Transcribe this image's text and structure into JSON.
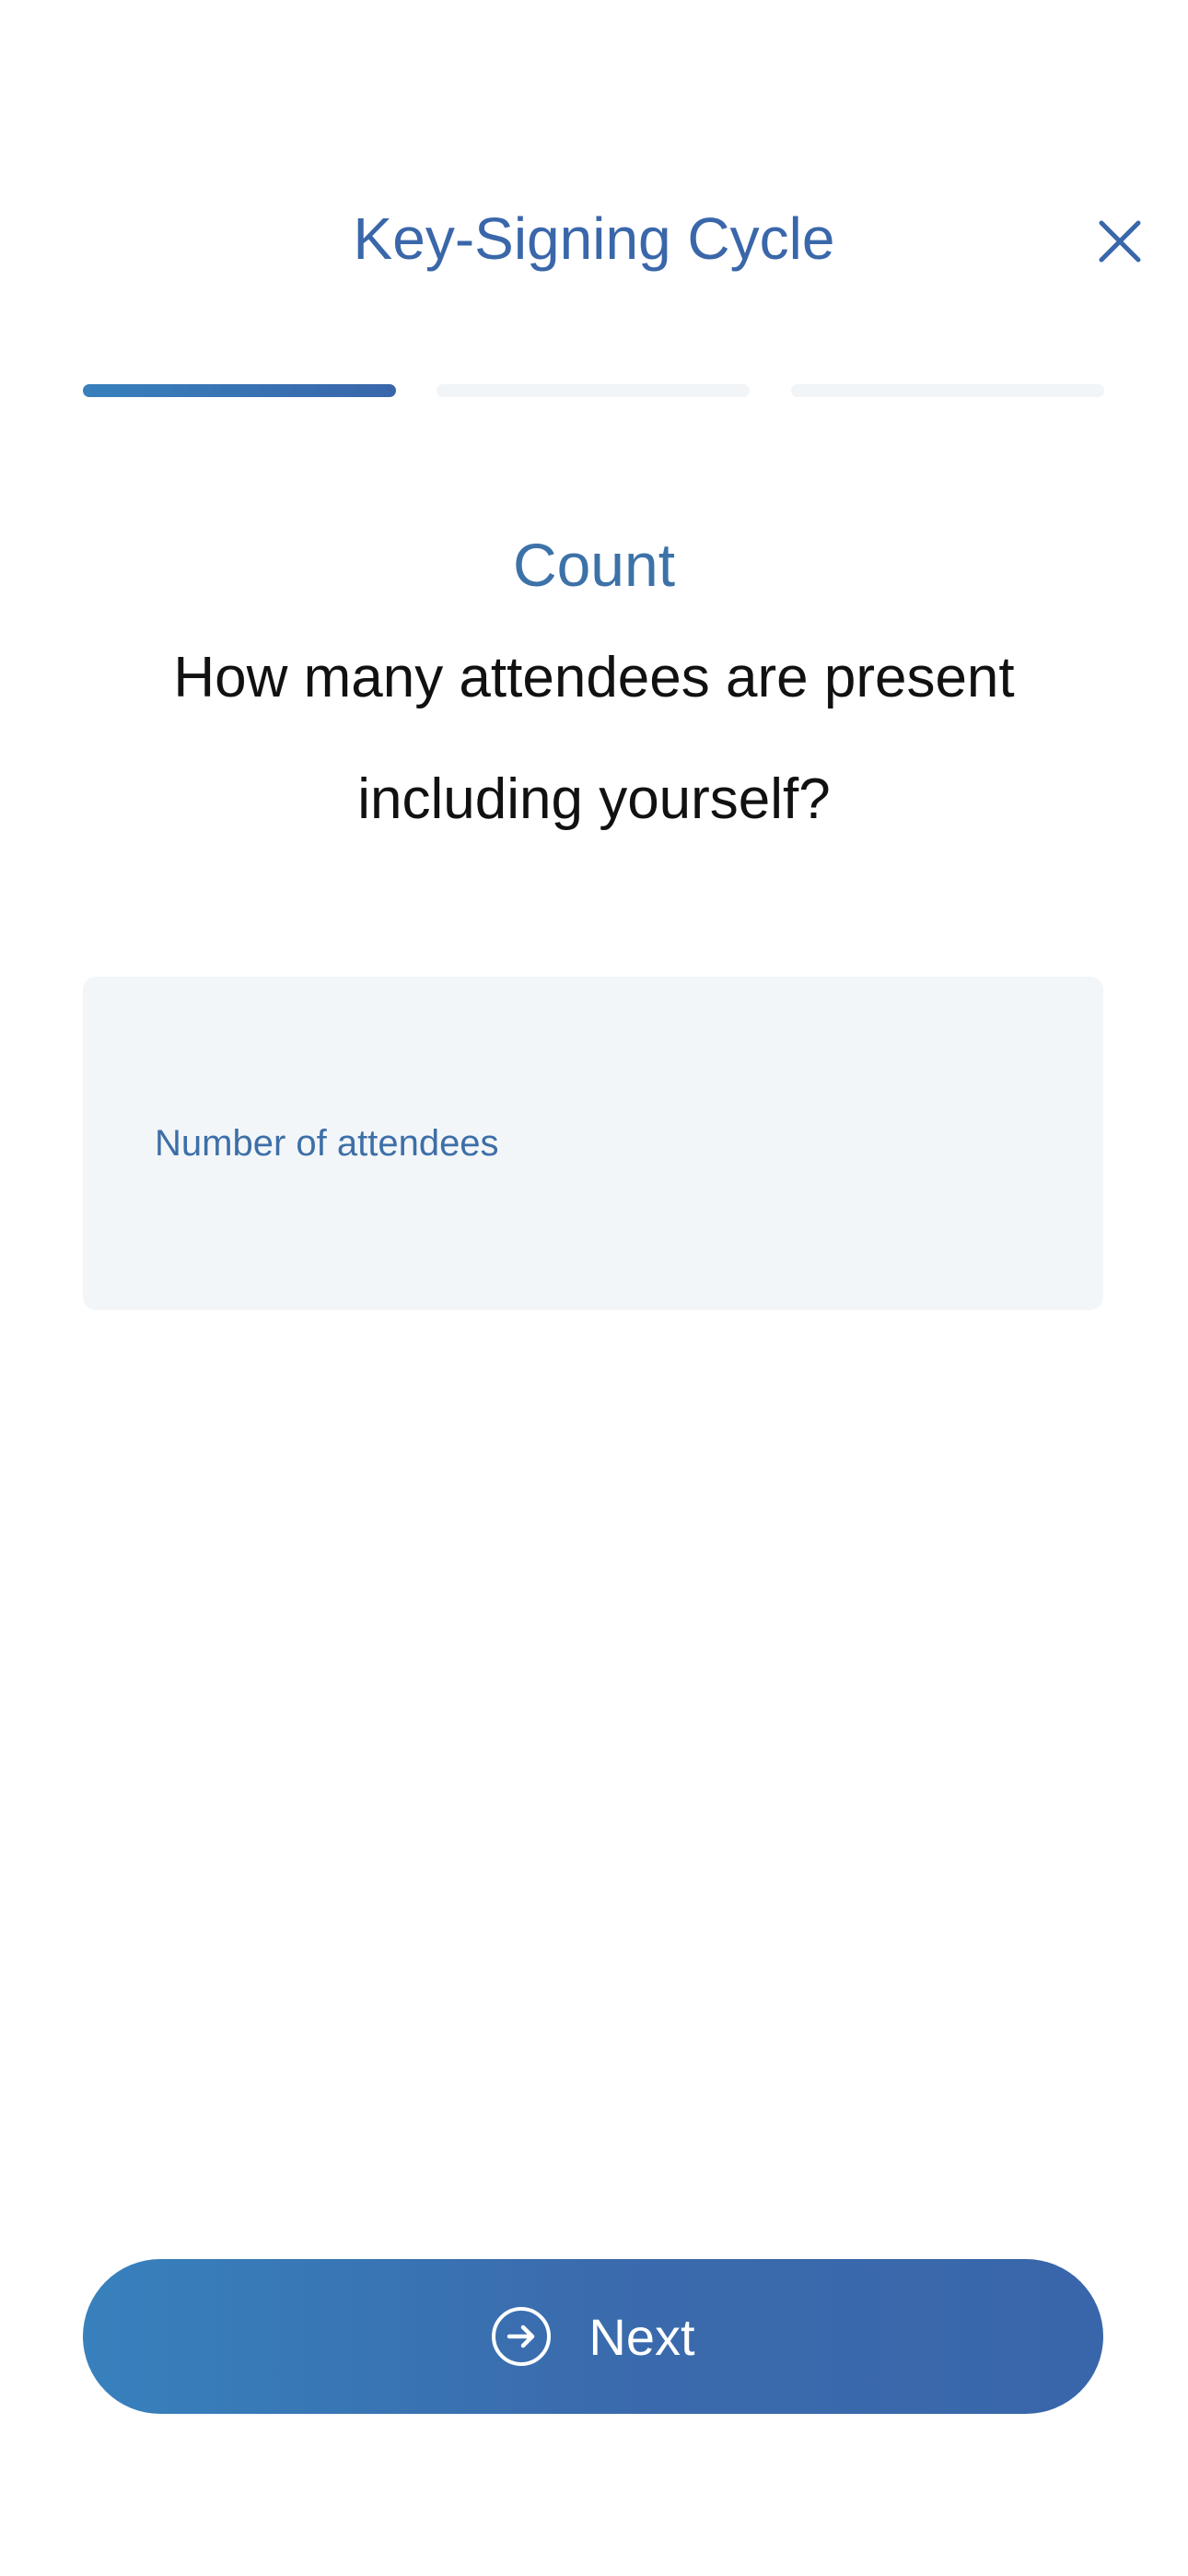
{
  "header": {
    "title": "Key-Signing Cycle",
    "close_icon": "close-icon"
  },
  "progress": {
    "total_steps": 3,
    "current_step": 1
  },
  "step": {
    "section": "Count",
    "question": "How many attendees are present including yourself?"
  },
  "attendees_input": {
    "value": "",
    "placeholder": "Number of attendees"
  },
  "next_button": {
    "label": "Next",
    "icon": "arrow-right-circle-icon"
  },
  "colors": {
    "accent": "#3a67aa",
    "gradient_start": "#3781bd",
    "field_bg": "#f3f6f8"
  }
}
